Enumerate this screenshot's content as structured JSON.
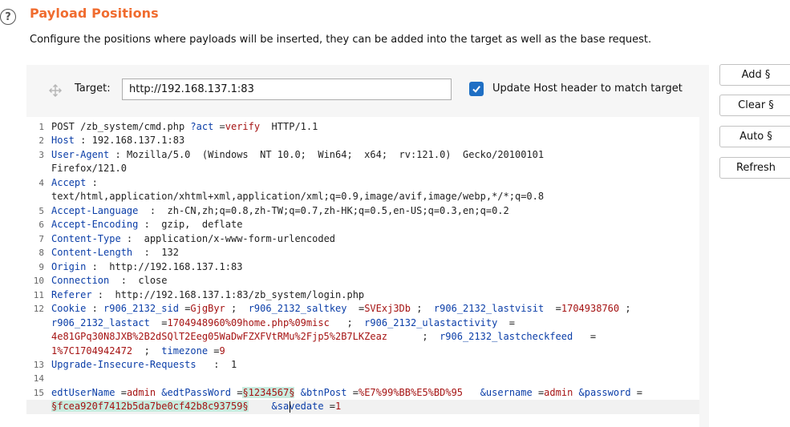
{
  "section": {
    "title": "Payload Positions",
    "description": "Configure the positions where payloads will be inserted, they can be added into the target as well as the base request."
  },
  "target": {
    "label": "Target:",
    "value": "http://192.168.137.1:83",
    "update_host_label": "Update Host header to match target",
    "update_host_checked": true
  },
  "buttons": {
    "add": "Add §",
    "clear": "Clear §",
    "auto": "Auto §",
    "refresh": "Refresh"
  },
  "request": {
    "line_numbers": [
      "1",
      "2",
      "3",
      "4",
      "5",
      "6",
      "7",
      "8",
      "9",
      "10",
      "11",
      "12",
      "13",
      "14",
      "15"
    ],
    "l1": {
      "method": "POST /zb_system/cmd.php ",
      "qk": "?act",
      "eq": " =",
      "qv": "verify",
      "ver": "  HTTP/1.1"
    },
    "l2": {
      "k": "Host",
      "sep": " : ",
      "v": "192.168.137.1:83"
    },
    "l3": {
      "k": "User-Agent",
      "sep": " : ",
      "v": "Mozilla/5.0  (Windows  NT 10.0;  Win64;  x64;  rv:121.0)  Gecko/20100101",
      "v2": "Firefox/121.0"
    },
    "l4": {
      "k": "Accept",
      "sep": " :",
      "v": "text/html,application/xhtml+xml,application/xml;q=0.9,image/avif,image/webp,*/*;q=0.8"
    },
    "l5": {
      "k": "Accept-Language",
      "sep": "  :  ",
      "v": "zh-CN,zh;q=0.8,zh-TW;q=0.7,zh-HK;q=0.5,en-US;q=0.3,en;q=0.2"
    },
    "l6": {
      "k": "Accept-Encoding",
      "sep": " :  ",
      "v": "gzip,  deflate"
    },
    "l7": {
      "k": "Content-Type",
      "sep": " :  ",
      "v": "application/x-www-form-urlencoded"
    },
    "l8": {
      "k": "Content-Length",
      "sep": "  :  ",
      "v": "132"
    },
    "l9": {
      "k": "Origin",
      "sep": " :  ",
      "v": "http://192.168.137.1:83"
    },
    "l10": {
      "k": "Connection",
      "sep": "  :  ",
      "v": "close"
    },
    "l11": {
      "k": "Referer",
      "sep": " :  ",
      "v": "http://192.168.137.1:83/zb_system/login.php"
    },
    "l12": {
      "k": "Cookie",
      "sep": " : ",
      "c1k": "r906_2132_sid",
      "c1e": " =",
      "c1v": "GjgByr",
      "s1": " ;  ",
      "c2k": "r906_2132_saltkey",
      "c2e": "  =",
      "c2v": "SVExj3Db",
      "s2": " ;  ",
      "c3k": "r906_2132_lastvisit",
      "c3e": "  =",
      "c3v": "1704938760",
      "s3": " ;",
      "c4k": "r906_2132_lastact",
      "c4e": "  =",
      "c4v": "1704948960%09home.php%09misc",
      "s4": "   ;  ",
      "c5k": "r906_2132_ulastactivity",
      "c5e": "  =",
      "c5v": "4e81GPq30N8JXB%2B2dSQlT2Eeg05WaDwFZXFVtRMu%2Fjp5%2B7LKZeaz",
      "s5": "      ;  ",
      "c6k": "r906_2132_lastcheckfeed",
      "c6e": "   =",
      "c6v": "1%7C1704942472",
      "s6": "  ;  ",
      "c7k": "timezone",
      "c7e": " =",
      "c7v": "9"
    },
    "l13": {
      "k": "Upgrade-Insecure-Requests",
      "sep": "   :  ",
      "v": "1"
    },
    "l15": {
      "p1k": "edtUserName",
      "p1e": " =",
      "p1v": "admin",
      "a2": " &",
      "p2k": "edtPassWord",
      "p2e": " =",
      "p2v": "§1234567§",
      "a3": " &",
      "p3k": "btnPost",
      "p3e": " =",
      "p3v": "%E7%99%BB%E5%BD%95",
      "a4": "   &",
      "p4k": "username",
      "p4e": " =",
      "p4v": "admin",
      "a5": " &",
      "p5k": "password",
      "p5e": " =",
      "p5v": "§fcea920f7412b5da7be0cf42b8c93759§",
      "a6": "    &",
      "p6k": "savedate",
      "p6e": " =",
      "p6v": "1"
    }
  }
}
